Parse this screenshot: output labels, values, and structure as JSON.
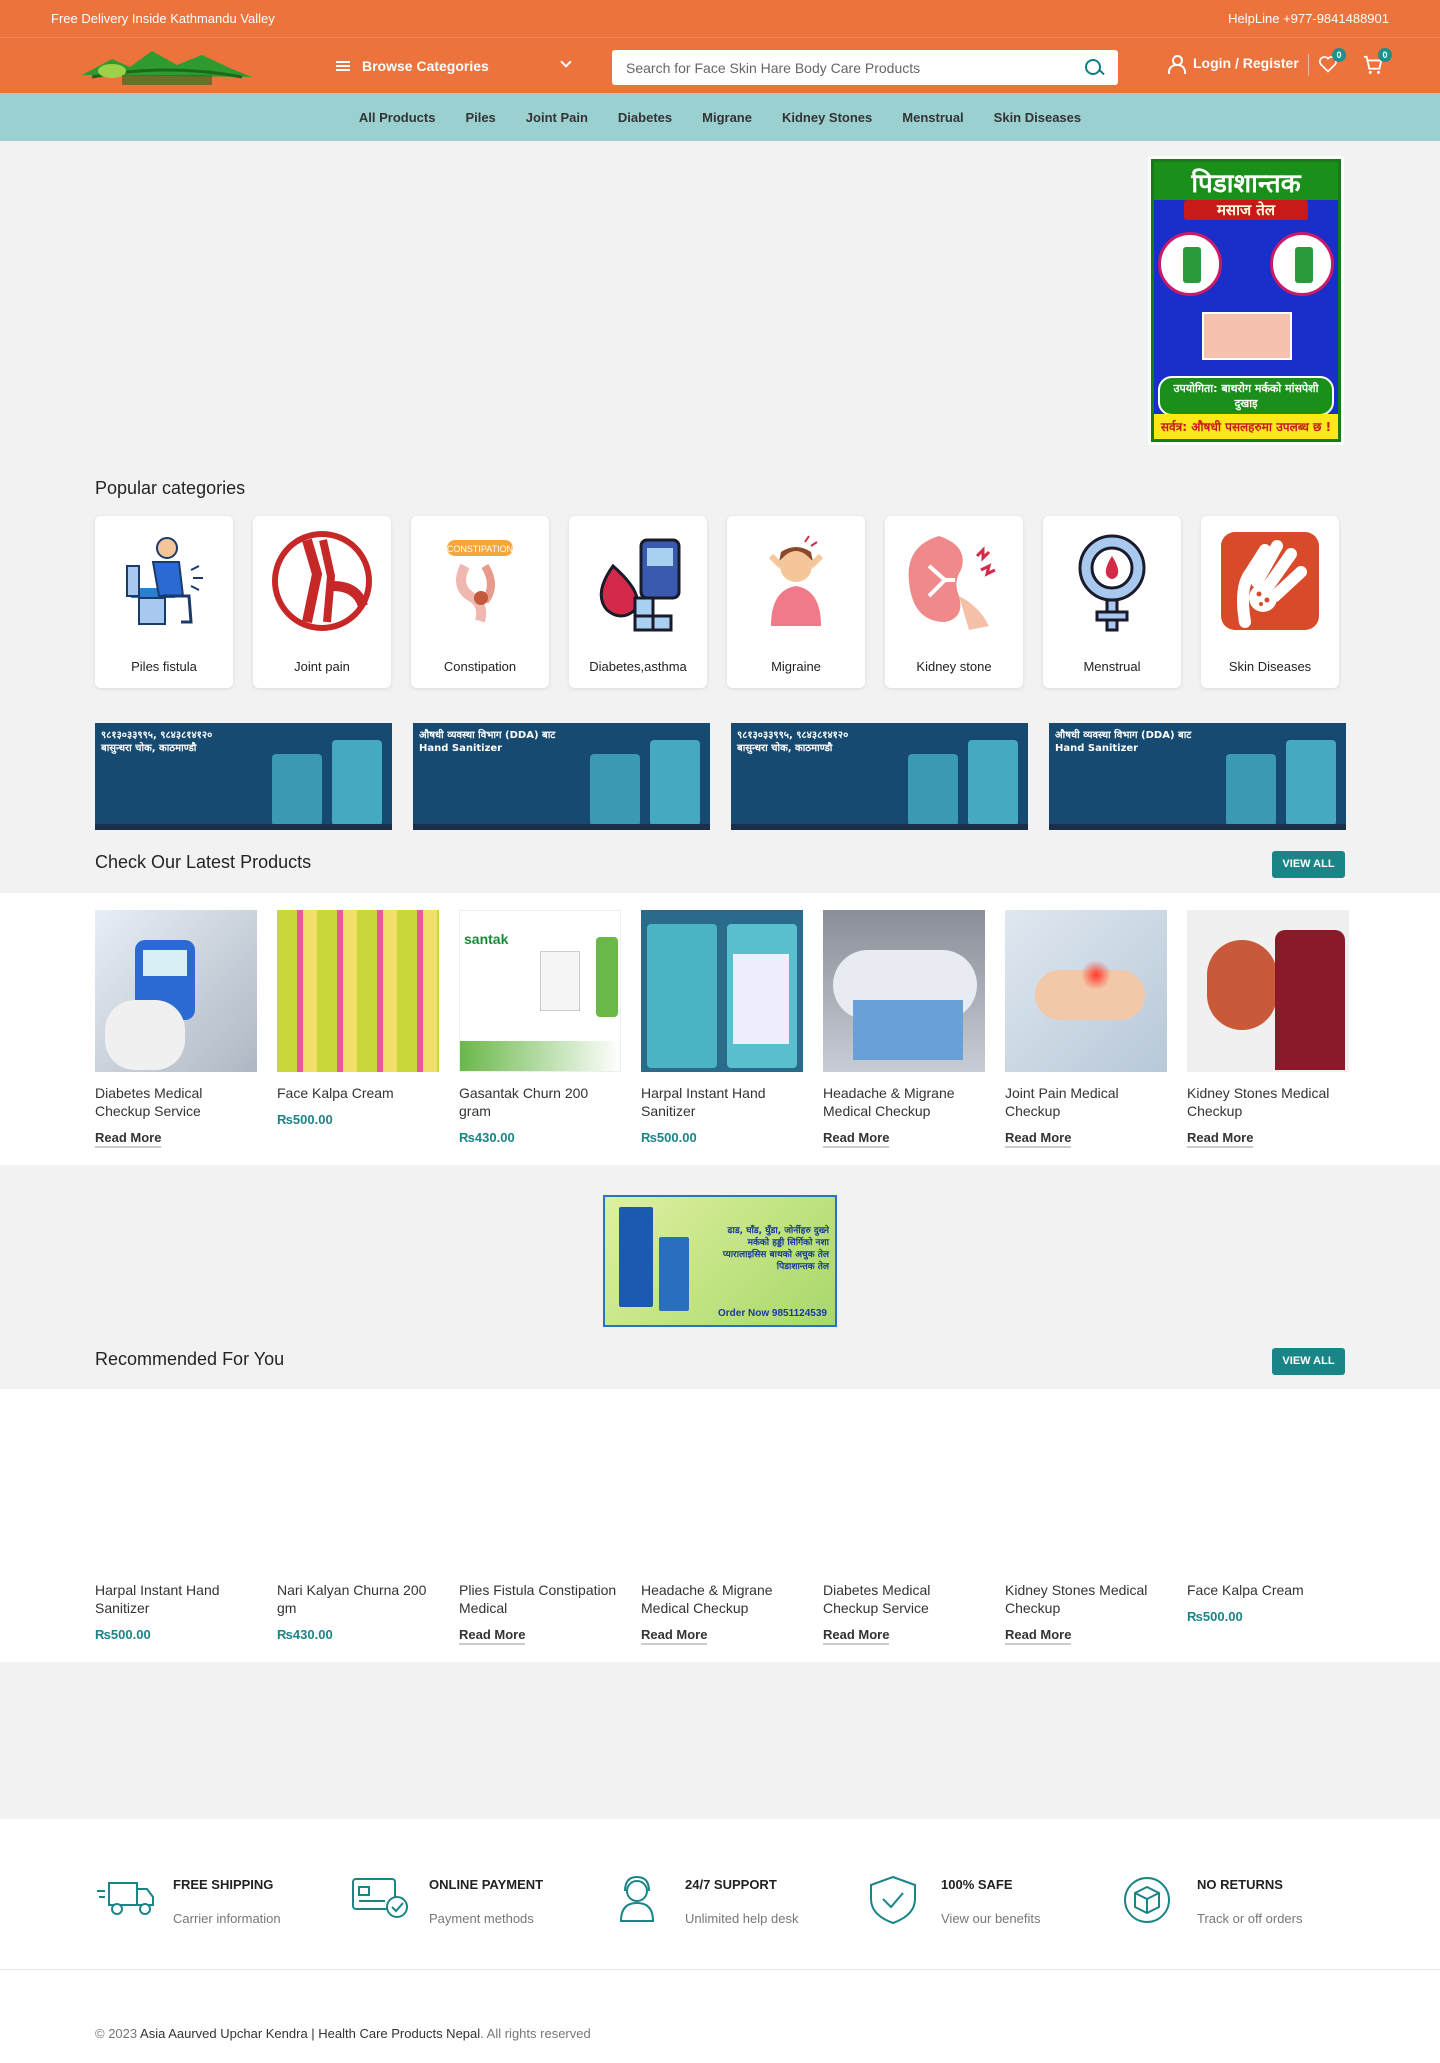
{
  "topbar": {
    "left": "Free Delivery Inside Kathmandu Valley",
    "right": "HelpLine +977-9841488901"
  },
  "header": {
    "browse_label": "Browse Categories",
    "search_placeholder": "Search for Face Skin Hare Body Care Products",
    "login_label": "Login / Register",
    "wishlist_count": "0",
    "cart_count": "0"
  },
  "catnav": [
    "All Products",
    "Piles",
    "Joint Pain",
    "Diabetes",
    "Migrane",
    "Kidney Stones",
    "Menstrual",
    "Skin Diseases"
  ],
  "hero_poster": {
    "title": "पिडाशान्तक",
    "subtitle": "मसाज तेल",
    "usage": "उपयोगिता: बाथरोग मर्कको मांसपेशी दुखाइ",
    "footer": "सर्वत्र: औषधी पसलहरुमा उपलब्ध छ !"
  },
  "popular": {
    "title": "Popular categories",
    "items": [
      {
        "label": "Piles fistula",
        "icon": "piles-icon"
      },
      {
        "label": "Joint pain",
        "icon": "joint-icon"
      },
      {
        "label": "Constipation",
        "icon": "constipation-icon"
      },
      {
        "label": "Diabetes,asthma",
        "icon": "diabetes-icon"
      },
      {
        "label": "Migraine",
        "icon": "migraine-icon"
      },
      {
        "label": "Kidney stone",
        "icon": "kidney-icon"
      },
      {
        "label": "Menstrual",
        "icon": "menstrual-icon"
      },
      {
        "label": "Skin Diseases",
        "icon": "skin-icon"
      }
    ]
  },
  "banners": [
    {
      "text": "९८१३०३३९९५, ९८४३८१४१२० बासुन्धरा चोक, काठमाण्डौ"
    },
    {
      "text": "औषधी व्यवस्था विभाग (DDA) बाट Hand Sanitizer"
    },
    {
      "text": "९८१३०३३९९५, ९८४३८१४१२० बासुन्धरा चोक, काठमाण्डौ"
    },
    {
      "text": "औषधी व्यवस्था विभाग (DDA) बाट Hand Sanitizer"
    }
  ],
  "latest": {
    "title": "Check Our Latest Products",
    "view_all": "VIEW ALL",
    "items": [
      {
        "name": "Diabetes Medical Checkup Service",
        "action": "Read More"
      },
      {
        "name": "Face Kalpa Cream",
        "price": "₨500.00"
      },
      {
        "name": "Gasantak Churn 200 gram",
        "price": "₨430.00"
      },
      {
        "name": "Harpal Instant Hand Sanitizer",
        "price": "₨500.00"
      },
      {
        "name": "Headache & Migrane Medical Checkup",
        "action": "Read More"
      },
      {
        "name": "Joint Pain Medical Checkup",
        "action": "Read More"
      },
      {
        "name": "Kidney Stones Medical Checkup",
        "action": "Read More"
      }
    ]
  },
  "mid_banner": {
    "text": "ढाड, घाँड, घुँडा, जोर्नीहरु दुख्ने मर्कको हड्डी सिर्गिको नशा प्यारालाइसिस बाथको अचुक तेल पिडाशान्तक तेल",
    "order": "Order Now",
    "phone": "9851124539"
  },
  "recommended": {
    "title": "Recommended For You",
    "view_all": "VIEW ALL",
    "items": [
      {
        "name": "Harpal Instant Hand Sanitizer",
        "price": "₨500.00"
      },
      {
        "name": "Nari Kalyan Churna 200 gm",
        "price": "₨430.00"
      },
      {
        "name": "Plies Fistula Constipation Medical",
        "action": "Read More"
      },
      {
        "name": "Headache & Migrane Medical Checkup",
        "action": "Read More"
      },
      {
        "name": "Diabetes Medical Checkup Service",
        "action": "Read More"
      },
      {
        "name": "Kidney Stones Medical Checkup",
        "action": "Read More"
      },
      {
        "name": "Face Kalpa Cream",
        "price": "₨500.00"
      }
    ]
  },
  "features": [
    {
      "title": "FREE SHIPPING",
      "sub": "Carrier information",
      "icon": "truck-icon"
    },
    {
      "title": "ONLINE PAYMENT",
      "sub": "Payment methods",
      "icon": "card-icon"
    },
    {
      "title": "24/7 SUPPORT",
      "sub": "Unlimited help desk",
      "icon": "support-icon"
    },
    {
      "title": "100% SAFE",
      "sub": "View our benefits",
      "icon": "shield-icon"
    },
    {
      "title": "NO RETURNS",
      "sub": "Track or off orders",
      "icon": "box-icon"
    }
  ],
  "footer": {
    "prefix": "© 2023",
    "site": "Asia Aaurved Upchar Kendra | Health Care Products Nepal",
    "suffix": "All rights reserved"
  },
  "colors": {
    "brand_orange": "#ec733b",
    "nav_teal": "#9bd0d1",
    "accent_teal": "#1a8587"
  }
}
